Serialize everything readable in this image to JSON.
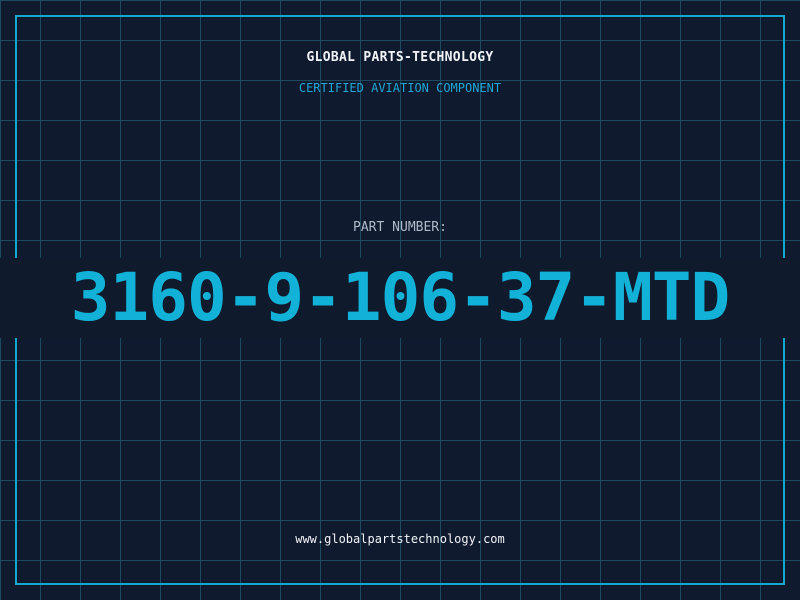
{
  "header": {
    "brand": "GLOBAL PARTS-TECHNOLOGY",
    "subtitle": "CERTIFIED AVIATION COMPONENT"
  },
  "part": {
    "label": "PART NUMBER:",
    "number": "3160-9-106-37-MTD"
  },
  "footer": {
    "website": "www.globalpartstechnology.com"
  },
  "colors": {
    "background": "#101a2e",
    "grid": "#1d4a5e",
    "accent": "#12b2d8",
    "text": "#f1f4f8",
    "muted": "#aebbc9"
  }
}
